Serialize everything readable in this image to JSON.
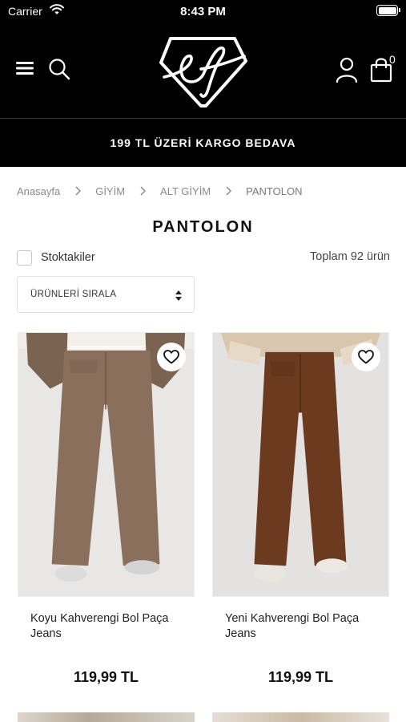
{
  "status_bar": {
    "carrier": "Carrier",
    "time": "8:43 PM"
  },
  "header": {
    "logo_alt": "ef",
    "cart_count": "0"
  },
  "announcement": "199 TL ÜZERİ KARGO BEDAVA",
  "breadcrumb": [
    "Anasayfa",
    "GİYİM",
    "ALT GİYİM",
    "PANTOLON"
  ],
  "page_title": "PANTOLON",
  "filter": {
    "stock_label": "Stoktakiler",
    "stock_checked": false,
    "total_count": "Toplam 92 ürün"
  },
  "sort": {
    "label": "ÜRÜNLERİ SIRALA"
  },
  "products": [
    {
      "name": "Koyu Kahverengi Bol Paça Jeans",
      "price": "119,99 TL",
      "color": "#8a6f5c"
    },
    {
      "name": "Yeni Kahverengi Bol Paça Jeans",
      "price": "119,99 TL",
      "color": "#6b3a1f"
    }
  ],
  "colors": {
    "header_bg": "#000000",
    "accent_text": "#ffffff",
    "muted_text": "#8a8a8a"
  },
  "icons": {
    "menu": "hamburger-menu-icon",
    "search": "search-icon",
    "account": "user-icon",
    "cart": "shopping-bag-icon",
    "favorite": "heart-icon",
    "breadcrumb_separator": "chevron-right-icon",
    "sort": "up-down-arrows-icon"
  }
}
